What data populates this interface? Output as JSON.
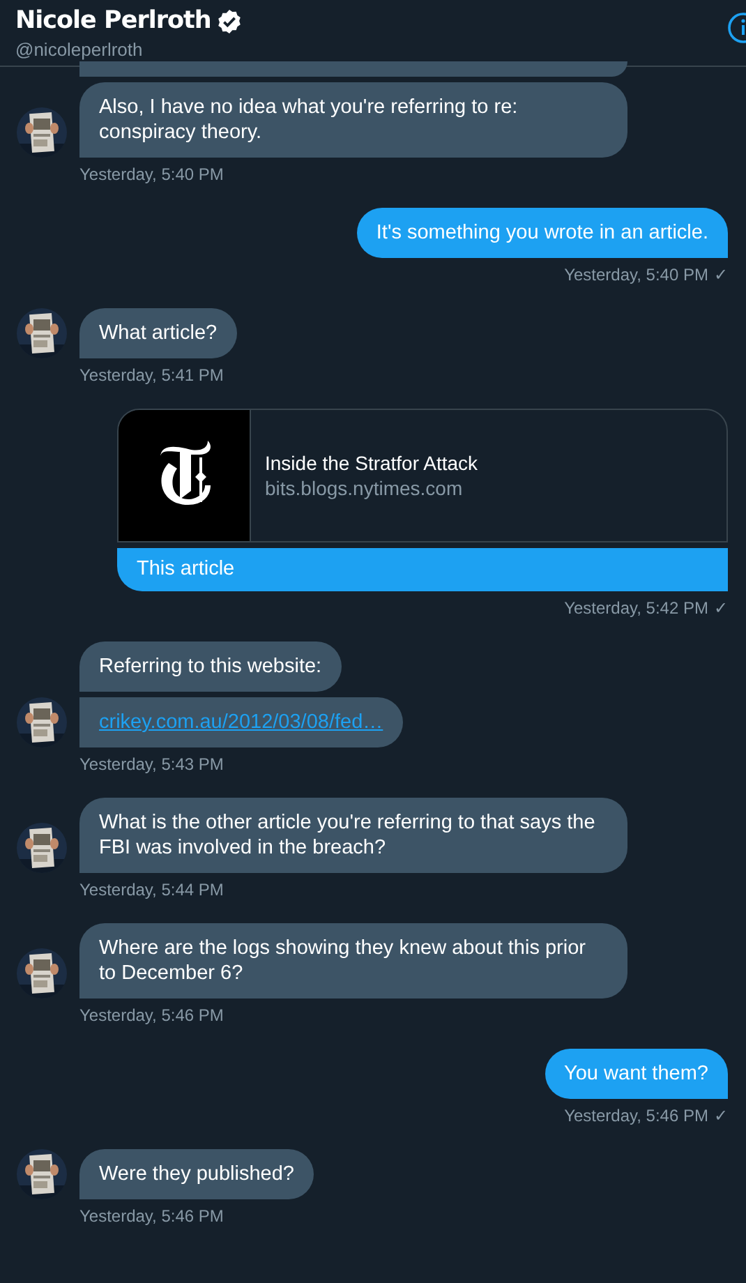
{
  "header": {
    "name": "Nicole Perlroth",
    "handle": "@nicoleperlroth"
  },
  "messages": [
    {
      "kind": "received",
      "bubbles": [
        {
          "kind": "cut"
        },
        {
          "kind": "text",
          "text": "Also, I have no idea what you're referring to re: conspiracy theory."
        }
      ],
      "time": "Yesterday, 5:40 PM"
    },
    {
      "kind": "sent",
      "bubbles": [
        {
          "kind": "text",
          "text": "It's something you wrote in an article."
        }
      ],
      "time": "Yesterday, 5:40 PM",
      "receipt": "✓"
    },
    {
      "kind": "received",
      "bubbles": [
        {
          "kind": "text",
          "text": "What article?"
        }
      ],
      "time": "Yesterday, 5:41 PM"
    },
    {
      "kind": "sent",
      "bubbles": [
        {
          "kind": "card",
          "title": "Inside the Stratfor Attack",
          "domain": "bits.blogs.nytimes.com"
        },
        {
          "kind": "text",
          "text": "This article"
        }
      ],
      "time": "Yesterday, 5:42 PM",
      "receipt": "✓"
    },
    {
      "kind": "received",
      "bubbles": [
        {
          "kind": "text",
          "text": "Referring to this website:"
        },
        {
          "kind": "link",
          "text": "crikey.com.au/2012/03/08/fed…"
        }
      ],
      "time": "Yesterday, 5:43 PM"
    },
    {
      "kind": "received",
      "bubbles": [
        {
          "kind": "text",
          "text": "What is the other article you're referring to that says the FBI  was involved in the breach?"
        }
      ],
      "time": "Yesterday, 5:44 PM"
    },
    {
      "kind": "received",
      "bubbles": [
        {
          "kind": "text",
          "text": "Where are the logs showing they knew about this prior to December 6?"
        }
      ],
      "time": "Yesterday, 5:46 PM"
    },
    {
      "kind": "sent",
      "bubbles": [
        {
          "kind": "text",
          "text": "You want them?"
        }
      ],
      "time": "Yesterday, 5:46 PM",
      "receipt": "✓"
    },
    {
      "kind": "received",
      "bubbles": [
        {
          "kind": "text",
          "text": "Were they published?"
        }
      ],
      "time": "Yesterday, 5:46 PM"
    }
  ]
}
